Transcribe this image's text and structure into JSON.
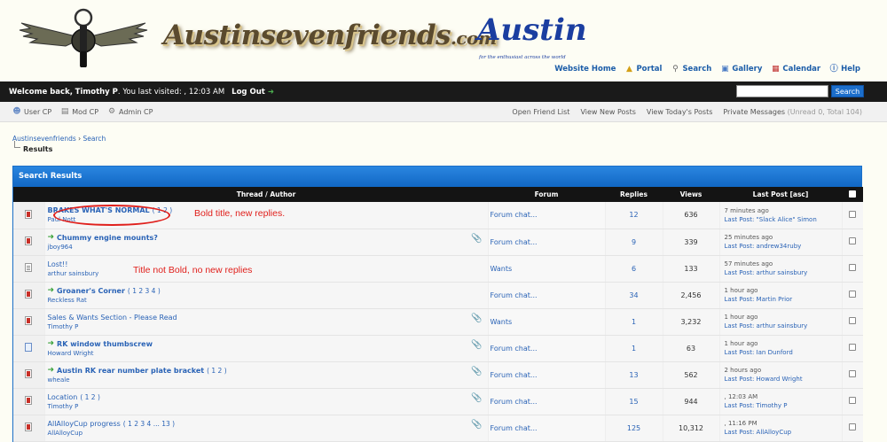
{
  "header": {
    "site_title": "Austinsevenfriends",
    "site_title_suffix": ".com",
    "brand_word": "Austin",
    "brand_tagline": "for the enthusiast across the world",
    "links": [
      {
        "label": "Website Home",
        "icon": "none"
      },
      {
        "label": "Portal",
        "icon": "bell-icon"
      },
      {
        "label": "Search",
        "icon": "magnifier-icon"
      },
      {
        "label": "Gallery",
        "icon": "gallery-icon"
      },
      {
        "label": "Calendar",
        "icon": "calendar-icon"
      },
      {
        "label": "Help",
        "icon": "help-icon"
      }
    ]
  },
  "welcome": {
    "prefix": "Welcome back,",
    "user": "Timothy P",
    "visited": ". You last visited: , 12:03 AM",
    "logout": "Log Out",
    "search_button": "Search",
    "search_value": ""
  },
  "subnav": {
    "left": [
      "User CP",
      "Mod CP",
      "Admin CP"
    ],
    "right": [
      "Open Friend List",
      "View New Posts",
      "View Today's Posts"
    ],
    "pm_label": "Private Messages",
    "pm_counts": "(Unread 0, Total 104)"
  },
  "breadcrumb": {
    "items": [
      "Austinsevenfriends",
      "Search"
    ],
    "separator": "›",
    "current": "Results"
  },
  "results": {
    "panel_title": "Search Results",
    "columns": [
      "Thread / Author",
      "Forum",
      "Replies",
      "Views",
      "Last Post [asc]"
    ],
    "rows": [
      {
        "title": "BRAKES WHAT'S NORMAL",
        "bold": true,
        "new": false,
        "pages": "( 1 2 )",
        "author": "Paul Nott",
        "forum": "Forum chat...",
        "replies": "12",
        "views": "636",
        "last_time": "7 minutes ago",
        "last_by": "\"Slack Alice\" Simon",
        "attach": false,
        "icon": "hot"
      },
      {
        "title": "Chummy engine mounts?",
        "bold": true,
        "new": true,
        "pages": "",
        "author": "jboy964",
        "forum": "Forum chat...",
        "replies": "9",
        "views": "339",
        "last_time": "25 minutes ago",
        "last_by": "andrew34ruby",
        "attach": true,
        "icon": "hot"
      },
      {
        "title": "Lost!!",
        "bold": false,
        "new": false,
        "pages": "",
        "author": "arthur sainsbury",
        "forum": "Wants",
        "replies": "6",
        "views": "133",
        "last_time": "57 minutes ago",
        "last_by": "arthur sainsbury",
        "attach": false,
        "icon": "plain"
      },
      {
        "title": "Groaner's Corner",
        "bold": true,
        "new": true,
        "pages": "( 1 2 3 4 )",
        "author": "Reckless Rat",
        "forum": "Forum chat...",
        "replies": "34",
        "views": "2,456",
        "last_time": "1 hour ago",
        "last_by": "Martin Prior",
        "attach": false,
        "icon": "hot"
      },
      {
        "title": "Sales & Wants Section - Please Read",
        "bold": false,
        "new": false,
        "pages": "",
        "author": "Timothy P",
        "forum": "Wants",
        "replies": "1",
        "views": "3,232",
        "last_time": "1 hour ago",
        "last_by": "arthur sainsbury",
        "attach": true,
        "icon": "hot"
      },
      {
        "title": "RK window thumbscrew",
        "bold": true,
        "new": true,
        "pages": "",
        "author": "Howard Wright",
        "forum": "Forum chat...",
        "replies": "1",
        "views": "63",
        "last_time": "1 hour ago",
        "last_by": "Ian Dunford",
        "attach": true,
        "icon": "blue"
      },
      {
        "title": "Austin RK rear number plate bracket",
        "bold": true,
        "new": true,
        "pages": "( 1 2 )",
        "author": "wheale",
        "forum": "Forum chat...",
        "replies": "13",
        "views": "562",
        "last_time": "2 hours ago",
        "last_by": "Howard Wright",
        "attach": true,
        "icon": "hot"
      },
      {
        "title": "Location",
        "bold": false,
        "new": false,
        "pages": "( 1 2 )",
        "author": "Timothy P",
        "forum": "Forum chat...",
        "replies": "15",
        "views": "944",
        "last_time": ", 12:03 AM",
        "last_by": "Timothy P",
        "attach": true,
        "icon": "hot"
      },
      {
        "title": "AllAlloyCup progress",
        "bold": false,
        "new": false,
        "pages": "( 1 2 3 4 ... 13 )",
        "author": "AllAlloyCup",
        "forum": "Forum chat...",
        "replies": "125",
        "views": "10,312",
        "last_time": ", 11:16 PM",
        "last_by": "AllAlloyCup",
        "attach": true,
        "icon": "hot"
      }
    ],
    "last_by_prefix": "Last Post:"
  },
  "annotations": {
    "bold_note": "Bold title, new replies.",
    "notbold_note": "Title not Bold, no new replies"
  },
  "colors": {
    "accent_blue": "#1c6ecb",
    "link_blue": "#2a63b6",
    "annotation_red": "#e0201c",
    "bar_black": "#1a1a1a"
  }
}
